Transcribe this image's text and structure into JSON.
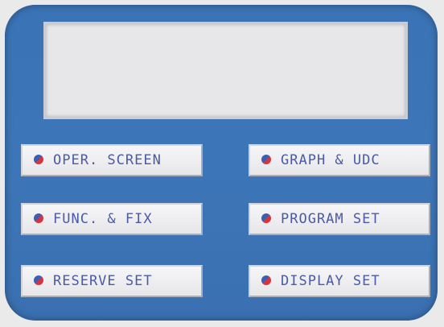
{
  "display": {
    "text": ""
  },
  "buttons": [
    {
      "label": "OPER. SCREEN",
      "icon": "menu-bullet-icon"
    },
    {
      "label": "GRAPH & UDC",
      "icon": "menu-bullet-icon"
    },
    {
      "label": "FUNC. & FIX",
      "icon": "menu-bullet-icon"
    },
    {
      "label": "PROGRAM SET",
      "icon": "menu-bullet-icon"
    },
    {
      "label": "RESERVE SET",
      "icon": "menu-bullet-icon"
    },
    {
      "label": "DISPLAY SET",
      "icon": "menu-bullet-icon"
    }
  ],
  "colors": {
    "panel": "#3a74b6",
    "button_text": "#4a5aa8",
    "icon_red": "#d8343c",
    "icon_blue": "#3a5fb5"
  }
}
